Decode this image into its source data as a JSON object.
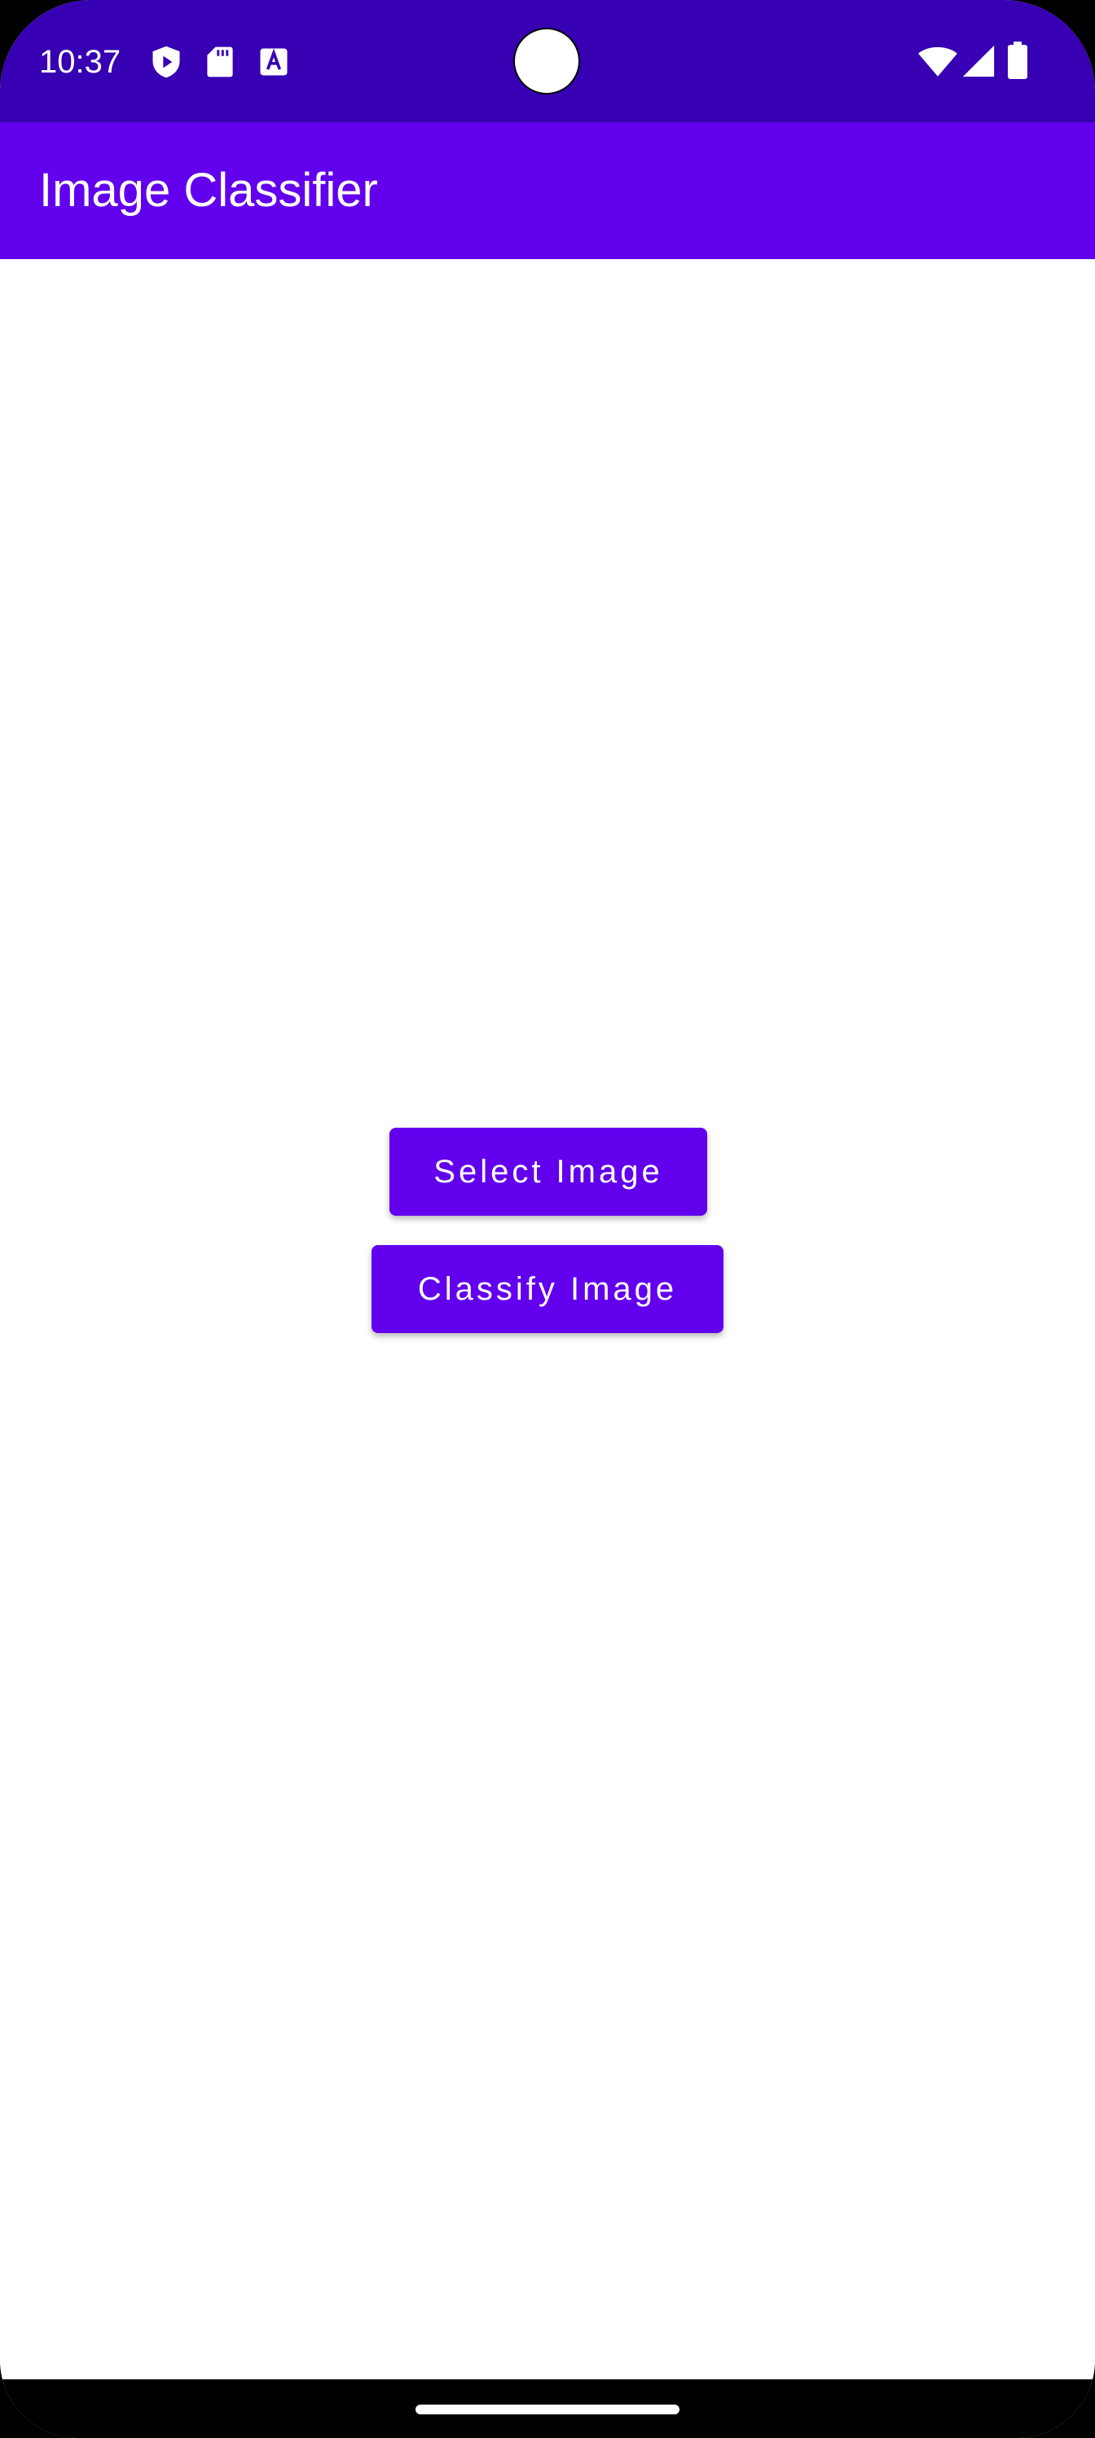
{
  "status_bar": {
    "time": "10:37",
    "left_icons": [
      "shield-play-icon",
      "sd-card-icon",
      "text-a-icon"
    ],
    "right_icons": [
      "wifi-icon",
      "cell-signal-icon",
      "battery-icon"
    ]
  },
  "app_bar": {
    "title": "Image Classifier"
  },
  "actions": {
    "select_label": "Select Image",
    "classify_label": "Classify Image"
  },
  "colors": {
    "status_bar": "#3700b3",
    "primary": "#6200ee",
    "background": "#ffffff"
  }
}
